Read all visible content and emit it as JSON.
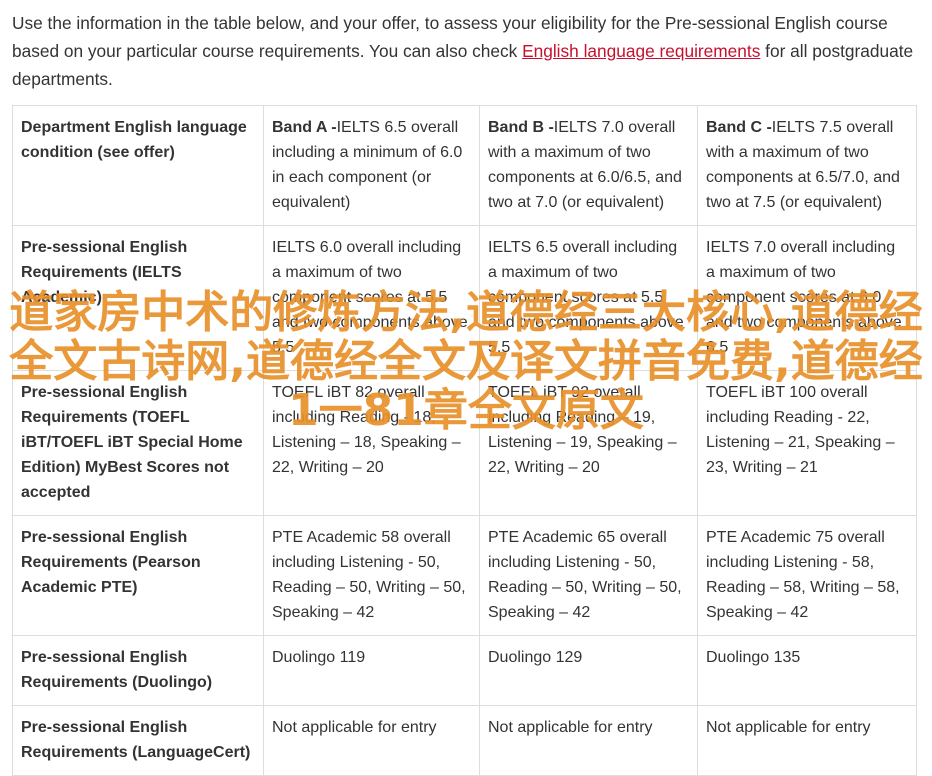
{
  "intro": {
    "before_link": "Use the information in the table below, and your offer, to assess your eligibility for the Pre-sessional English course based on your particular course requirements. You can also check ",
    "link": "English language requirements",
    "after_link": " for all postgraduate departments."
  },
  "table": {
    "header": {
      "col0": "Department English language condition (see offer)",
      "bandA_label": "Band A -",
      "bandA_text": "IELTS 6.5 overall including a minimum of 6.0 in each component (or equivalent)",
      "bandB_label": "Band B -",
      "bandB_text": "IELTS 7.0 overall with a maximum of two components at 6.0/6.5, and two at 7.0 (or equivalent)",
      "bandC_label": "Band C -",
      "bandC_text": "IELTS 7.5 overall with a maximum of two components at 6.5/7.0, and two at 7.5 (or equivalent)"
    },
    "rows": [
      {
        "label": "Pre-sessional English Requirements (IELTS Academic)",
        "a": "IELTS 6.0 overall including a maximum of two component scores at 5.5 and two components above 5.5",
        "b": "IELTS 6.5 overall including a maximum of two component scores at 5.5 and two components above 5.5",
        "c": "IELTS 7.0 overall including a maximum of two component scores at 6.0 and two components above 6.5"
      },
      {
        "label": "Pre-sessional English Requirements (TOEFL iBT/TOEFL iBT Special Home Edition) MyBest Scores not accepted",
        "a": "TOEFL iBT 82 overall including Reading - 18, Listening – 18, Speaking – 22, Writing – 20",
        "b": "TOEFL iBT 92 overall including Reading – 19, Listening – 19, Speaking – 22, Writing – 20",
        "c": "TOEFL iBT 100 overall including Reading - 22, Listening – 21, Speaking – 23, Writing – 21"
      },
      {
        "label": "Pre-sessional English Requirements (Pearson Academic PTE)",
        "a": "PTE Academic 58 overall including Listening - 50, Reading – 50, Writing – 50, Speaking – 42",
        "b": "PTE Academic 65 overall including Listening - 50, Reading – 50, Writing – 50, Speaking – 42",
        "c": "PTE Academic 75 overall including Listening - 58, Reading – 58, Writing – 58, Speaking – 42"
      },
      {
        "label": "Pre-sessional English Requirements (Duolingo)",
        "a": "Duolingo 119",
        "b": "Duolingo 129",
        "c": "Duolingo 135"
      },
      {
        "label": "Pre-sessional English Requirements (LanguageCert)",
        "a": "Not applicable for entry",
        "b": "Not applicable for entry",
        "c": "Not applicable for entry"
      }
    ]
  },
  "watermark": "道家房中术的修炼方法,道德经三大核心,道德经全文古诗网,道德经全文及译文拼音免费,道德经1一81章全文原文"
}
